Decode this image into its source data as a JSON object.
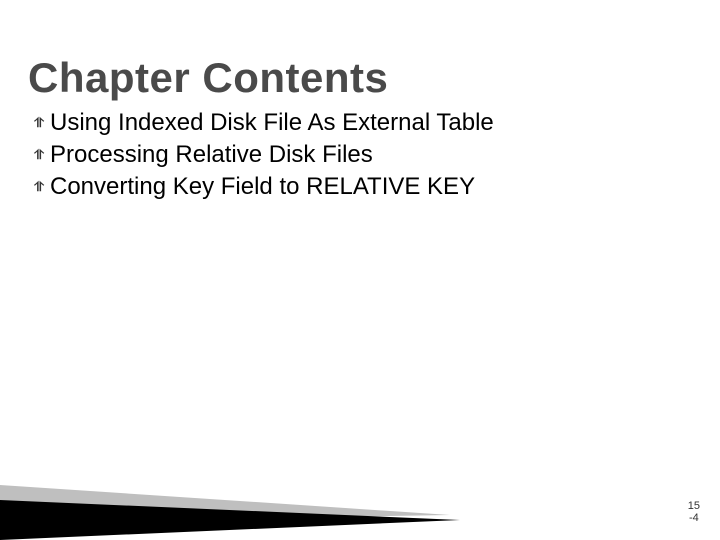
{
  "title": "Chapter Contents",
  "bullets": {
    "glyph": "⥣",
    "items": [
      "Using Indexed Disk File As External Table",
      "Processing Relative Disk Files",
      "Converting Key Field to RELATIVE KEY"
    ]
  },
  "page": {
    "chapter": "15",
    "num": "-4"
  },
  "decor": {
    "light": "#bfbfbf",
    "dark": "#000000"
  }
}
